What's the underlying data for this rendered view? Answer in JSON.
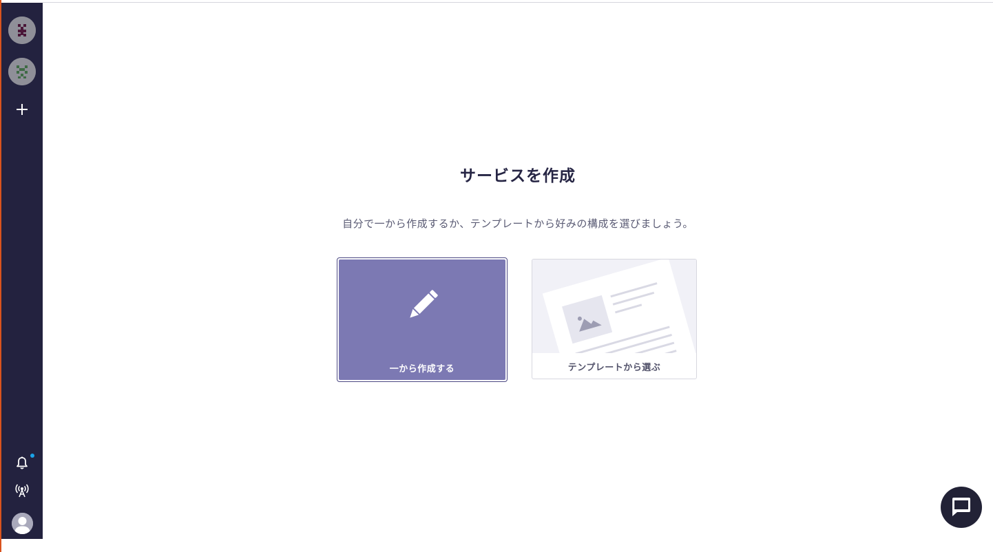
{
  "page": {
    "title": "サービスを作成",
    "subtitle": "自分で一から作成するか、テンプレートから好みの構成を選びましょう。"
  },
  "options": {
    "scratch_label": "一から作成する",
    "template_label": "テンプレートから選ぶ"
  },
  "sidebar": {
    "items": [
      {
        "type": "space-avatar",
        "icon": "identicon-pink"
      },
      {
        "type": "space-avatar",
        "icon": "identicon-green"
      },
      {
        "type": "add-space",
        "icon": "plus-icon"
      }
    ],
    "bottom": [
      {
        "icon": "bell-icon",
        "has_notification": true
      },
      {
        "icon": "broadcast-icon"
      },
      {
        "icon": "user-avatar-icon"
      }
    ]
  },
  "colors": {
    "sidebar_bg": "#23223f",
    "accent_edge": "#d9531e",
    "selected_card_bg": "#7c79b3",
    "selected_card_border": "#4b4882",
    "notification_dot": "#1aa3e8",
    "chat_button_bg": "#222236"
  }
}
